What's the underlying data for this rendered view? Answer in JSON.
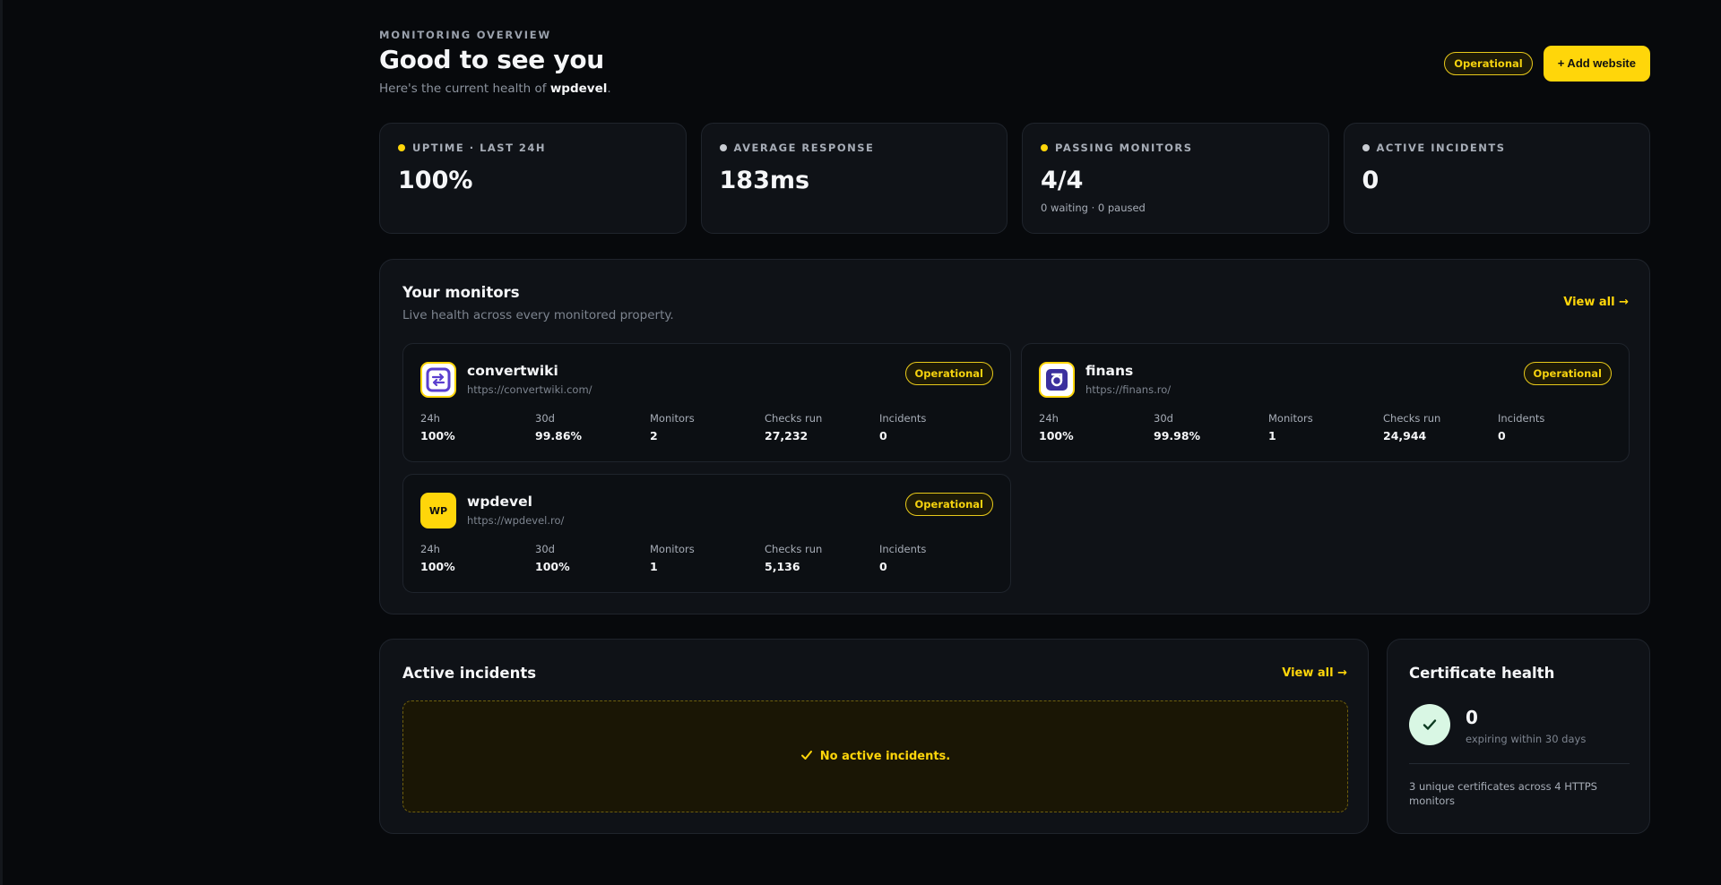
{
  "header": {
    "eyebrow": "MONITORING OVERVIEW",
    "title": "Good to see you",
    "subtitle_prefix": "Here's the current health of ",
    "subtitle_site": "wpdevel",
    "subtitle_suffix": ".",
    "status_badge": "Operational",
    "add_button": "+ Add website"
  },
  "stats": [
    {
      "label": "UPTIME · LAST 24H",
      "value": "100%",
      "sub": "",
      "dot": "#ffd60a"
    },
    {
      "label": "AVERAGE RESPONSE",
      "value": "183ms",
      "sub": "",
      "dot": "#c9ccd2"
    },
    {
      "label": "PASSING MONITORS",
      "value": "4/4",
      "sub": "0 waiting · 0 paused",
      "dot": "#ffd60a"
    },
    {
      "label": "ACTIVE INCIDENTS",
      "value": "0",
      "sub": "",
      "dot": "#c9ccd2"
    }
  ],
  "monitors": {
    "title": "Your monitors",
    "subtitle": "Live health across every monitored property.",
    "view_all": "View all →",
    "stat_labels": [
      "24h",
      "30d",
      "Monitors",
      "Checks run",
      "Incidents"
    ],
    "items": [
      {
        "name": "convertwiki",
        "url": "https://convertwiki.com/",
        "status": "Operational",
        "logo": "swap-arrows-icon",
        "values": [
          "100%",
          "99.86%",
          "2",
          "27,232",
          "0"
        ]
      },
      {
        "name": "finans",
        "url": "https://finans.ro/",
        "status": "Operational",
        "logo": "finans-logo-icon",
        "values": [
          "100%",
          "99.98%",
          "1",
          "24,944",
          "0"
        ]
      },
      {
        "name": "wpdevel",
        "url": "https://wpdevel.ro/",
        "status": "Operational",
        "logo_text": "WP",
        "values": [
          "100%",
          "100%",
          "1",
          "5,136",
          "0"
        ]
      }
    ]
  },
  "incidents": {
    "title": "Active incidents",
    "view_all": "View all →",
    "empty": "No active incidents."
  },
  "certificates": {
    "title": "Certificate health",
    "count": "0",
    "count_label": "expiring within 30 days",
    "note": "3 unique certificates across 4 HTTPS monitors"
  },
  "colors": {
    "accent": "#ffd60a",
    "background": "#07090c",
    "card": "#0f1217",
    "success": "#d9f7e4"
  }
}
